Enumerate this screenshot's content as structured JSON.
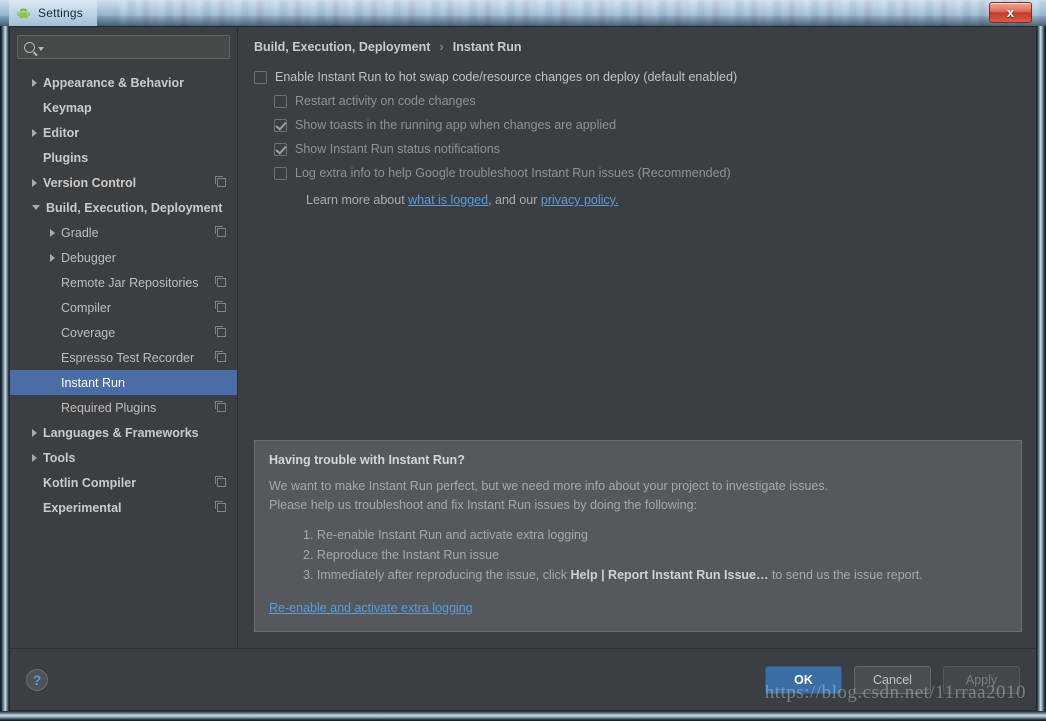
{
  "window": {
    "title": "Settings",
    "app_icon": "android-icon",
    "close_label": "x"
  },
  "search": {
    "value": "",
    "placeholder": "",
    "icon": "search-icon"
  },
  "tree": {
    "items": [
      {
        "label": "Appearance & Behavior",
        "level": 0,
        "arrow": "right",
        "bold": true,
        "project_icon": false,
        "selected": false
      },
      {
        "label": "Keymap",
        "level": 0,
        "arrow": "none",
        "bold": true,
        "project_icon": false,
        "selected": false
      },
      {
        "label": "Editor",
        "level": 0,
        "arrow": "right",
        "bold": true,
        "project_icon": false,
        "selected": false
      },
      {
        "label": "Plugins",
        "level": 0,
        "arrow": "none",
        "bold": true,
        "project_icon": false,
        "selected": false
      },
      {
        "label": "Version Control",
        "level": 0,
        "arrow": "right",
        "bold": true,
        "project_icon": true,
        "selected": false
      },
      {
        "label": "Build, Execution, Deployment",
        "level": 0,
        "arrow": "down",
        "bold": true,
        "project_icon": false,
        "selected": false
      },
      {
        "label": "Gradle",
        "level": 1,
        "arrow": "right",
        "bold": false,
        "project_icon": true,
        "selected": false
      },
      {
        "label": "Debugger",
        "level": 1,
        "arrow": "right",
        "bold": false,
        "project_icon": false,
        "selected": false
      },
      {
        "label": "Remote Jar Repositories",
        "level": 1,
        "arrow": "none",
        "bold": false,
        "project_icon": true,
        "selected": false
      },
      {
        "label": "Compiler",
        "level": 1,
        "arrow": "none",
        "bold": false,
        "project_icon": true,
        "selected": false
      },
      {
        "label": "Coverage",
        "level": 1,
        "arrow": "none",
        "bold": false,
        "project_icon": true,
        "selected": false
      },
      {
        "label": "Espresso Test Recorder",
        "level": 1,
        "arrow": "none",
        "bold": false,
        "project_icon": true,
        "selected": false
      },
      {
        "label": "Instant Run",
        "level": 1,
        "arrow": "none",
        "bold": false,
        "project_icon": false,
        "selected": true
      },
      {
        "label": "Required Plugins",
        "level": 1,
        "arrow": "none",
        "bold": false,
        "project_icon": true,
        "selected": false
      },
      {
        "label": "Languages & Frameworks",
        "level": 0,
        "arrow": "right",
        "bold": true,
        "project_icon": false,
        "selected": false
      },
      {
        "label": "Tools",
        "level": 0,
        "arrow": "right",
        "bold": true,
        "project_icon": false,
        "selected": false
      },
      {
        "label": "Kotlin Compiler",
        "level": 0,
        "arrow": "none",
        "bold": true,
        "project_icon": true,
        "selected": false
      },
      {
        "label": "Experimental",
        "level": 0,
        "arrow": "none",
        "bold": true,
        "project_icon": true,
        "selected": false
      }
    ]
  },
  "breadcrumb": {
    "parent": "Build, Execution, Deployment",
    "separator": "›",
    "current": "Instant Run"
  },
  "options": [
    {
      "label": "Enable Instant Run to hot swap code/resource changes on deploy (default enabled)",
      "checked": false,
      "indent": false,
      "dim": false
    },
    {
      "label": "Restart activity on code changes",
      "checked": false,
      "indent": true,
      "dim": true
    },
    {
      "label": "Show toasts in the running app when changes are applied",
      "checked": true,
      "indent": true,
      "dim": true
    },
    {
      "label": "Show Instant Run status notifications",
      "checked": true,
      "indent": true,
      "dim": true
    },
    {
      "label": "Log extra info to help Google troubleshoot Instant Run issues (Recommended)",
      "checked": false,
      "indent": true,
      "dim": true
    }
  ],
  "learn_more": {
    "prefix": "Learn more about ",
    "link1": "what is logged",
    "middle": ", and our ",
    "link2": "privacy policy.",
    "suffix": ""
  },
  "info_box": {
    "title": "Having trouble with Instant Run?",
    "para1": "We want to make Instant Run perfect, but we need more info about your project to investigate issues.",
    "para2": "Please help us troubleshoot and fix Instant Run issues by doing the following:",
    "steps": [
      {
        "num": "1.",
        "text": "Re-enable Instant Run and activate extra logging",
        "bold": "",
        "tail": ""
      },
      {
        "num": "2.",
        "text": "Reproduce the Instant Run issue",
        "bold": "",
        "tail": ""
      },
      {
        "num": "3.",
        "text": "Immediately after reproducing the issue, click ",
        "bold": "Help | Report Instant Run Issue…",
        "tail": " to send us the issue report."
      }
    ],
    "link": "Re-enable and activate extra logging"
  },
  "footer": {
    "help_label": "?",
    "ok_label": "OK",
    "cancel_label": "Cancel",
    "apply_label": "Apply"
  },
  "watermark": "https://blog.csdn.net/11rraa2010",
  "colors": {
    "panel_bg": "#3c3f41",
    "selection": "#4a6da7",
    "link": "#5a9bdc",
    "info_bg": "#55595c",
    "primary_button": "#3b6ea5"
  }
}
